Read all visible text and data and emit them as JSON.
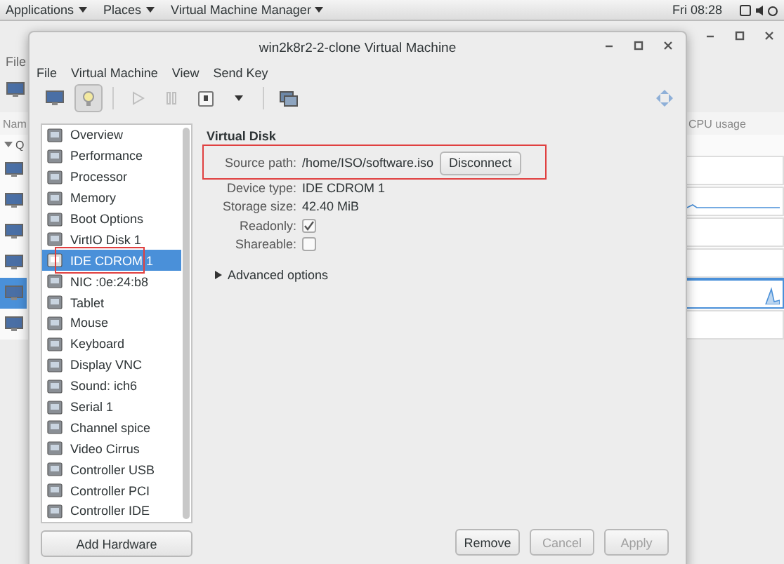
{
  "top_bar": {
    "menus": [
      {
        "label": "Applications"
      },
      {
        "label": "Places"
      },
      {
        "label": "Virtual Machine Manager"
      }
    ],
    "clock": "Fri 08:28"
  },
  "background_window": {
    "menu": "File",
    "column_1": "Nam",
    "cpu_column": "CPU usage",
    "group": "Q",
    "rows": [
      {
        "selected": false,
        "cpu_graph": false
      },
      {
        "selected": false,
        "cpu_graph": true
      },
      {
        "selected": false,
        "cpu_graph": false
      },
      {
        "selected": false,
        "cpu_graph": false
      },
      {
        "selected": true,
        "cpu_graph": true
      },
      {
        "selected": false,
        "cpu_graph": false
      }
    ]
  },
  "dialog": {
    "title": "win2k8r2-2-clone Virtual Machine",
    "menus": [
      "File",
      "Virtual Machine",
      "View",
      "Send Key"
    ],
    "toolbar": [
      {
        "kind": "monitor",
        "selected": false,
        "disabled": false
      },
      {
        "kind": "bulb",
        "selected": true,
        "disabled": false
      },
      {
        "kind": "play",
        "selected": false,
        "disabled": true
      },
      {
        "kind": "pause",
        "selected": false,
        "disabled": true
      },
      {
        "kind": "power",
        "selected": false,
        "disabled": false
      },
      {
        "kind": "caret",
        "selected": false,
        "disabled": false
      },
      {
        "kind": "screens",
        "selected": false,
        "disabled": false
      }
    ],
    "hardware": [
      {
        "label": "Overview",
        "selected": false,
        "highlighted": false
      },
      {
        "label": "Performance",
        "selected": false,
        "highlighted": false
      },
      {
        "label": "Processor",
        "selected": false,
        "highlighted": false
      },
      {
        "label": "Memory",
        "selected": false,
        "highlighted": false
      },
      {
        "label": "Boot Options",
        "selected": false,
        "highlighted": false
      },
      {
        "label": "VirtIO Disk 1",
        "selected": false,
        "highlighted": false
      },
      {
        "label": "IDE CDROM 1",
        "selected": true,
        "highlighted": true
      },
      {
        "label": "NIC :0e:24:b8",
        "selected": false,
        "highlighted": false
      },
      {
        "label": "Tablet",
        "selected": false,
        "highlighted": false
      },
      {
        "label": "Mouse",
        "selected": false,
        "highlighted": false
      },
      {
        "label": "Keyboard",
        "selected": false,
        "highlighted": false
      },
      {
        "label": "Display VNC",
        "selected": false,
        "highlighted": false
      },
      {
        "label": "Sound: ich6",
        "selected": false,
        "highlighted": false
      },
      {
        "label": "Serial 1",
        "selected": false,
        "highlighted": false
      },
      {
        "label": "Channel spice",
        "selected": false,
        "highlighted": false
      },
      {
        "label": "Video Cirrus",
        "selected": false,
        "highlighted": false
      },
      {
        "label": "Controller USB",
        "selected": false,
        "highlighted": false
      },
      {
        "label": "Controller PCI",
        "selected": false,
        "highlighted": false
      },
      {
        "label": "Controller IDE",
        "selected": false,
        "highlighted": false
      }
    ],
    "add_button": "Add Hardware",
    "section_title": "Virtual Disk",
    "source": {
      "label": "Source path:",
      "value": "/home/ISO/software.iso",
      "button": "Disconnect",
      "highlighted": true
    },
    "fields": [
      {
        "kind": "text",
        "label": "Device type:",
        "value": "IDE CDROM 1"
      },
      {
        "kind": "text",
        "label": "Storage size:",
        "value": "42.40 MiB"
      },
      {
        "kind": "checkbox",
        "label": "Readonly:",
        "checked": true
      },
      {
        "kind": "checkbox",
        "label": "Shareable:",
        "checked": false
      }
    ],
    "advanced": {
      "label": "Advanced options",
      "expanded": false
    },
    "buttons": [
      {
        "label": "Remove",
        "disabled": false
      },
      {
        "label": "Cancel",
        "disabled": true
      },
      {
        "label": "Apply",
        "disabled": true
      }
    ]
  }
}
